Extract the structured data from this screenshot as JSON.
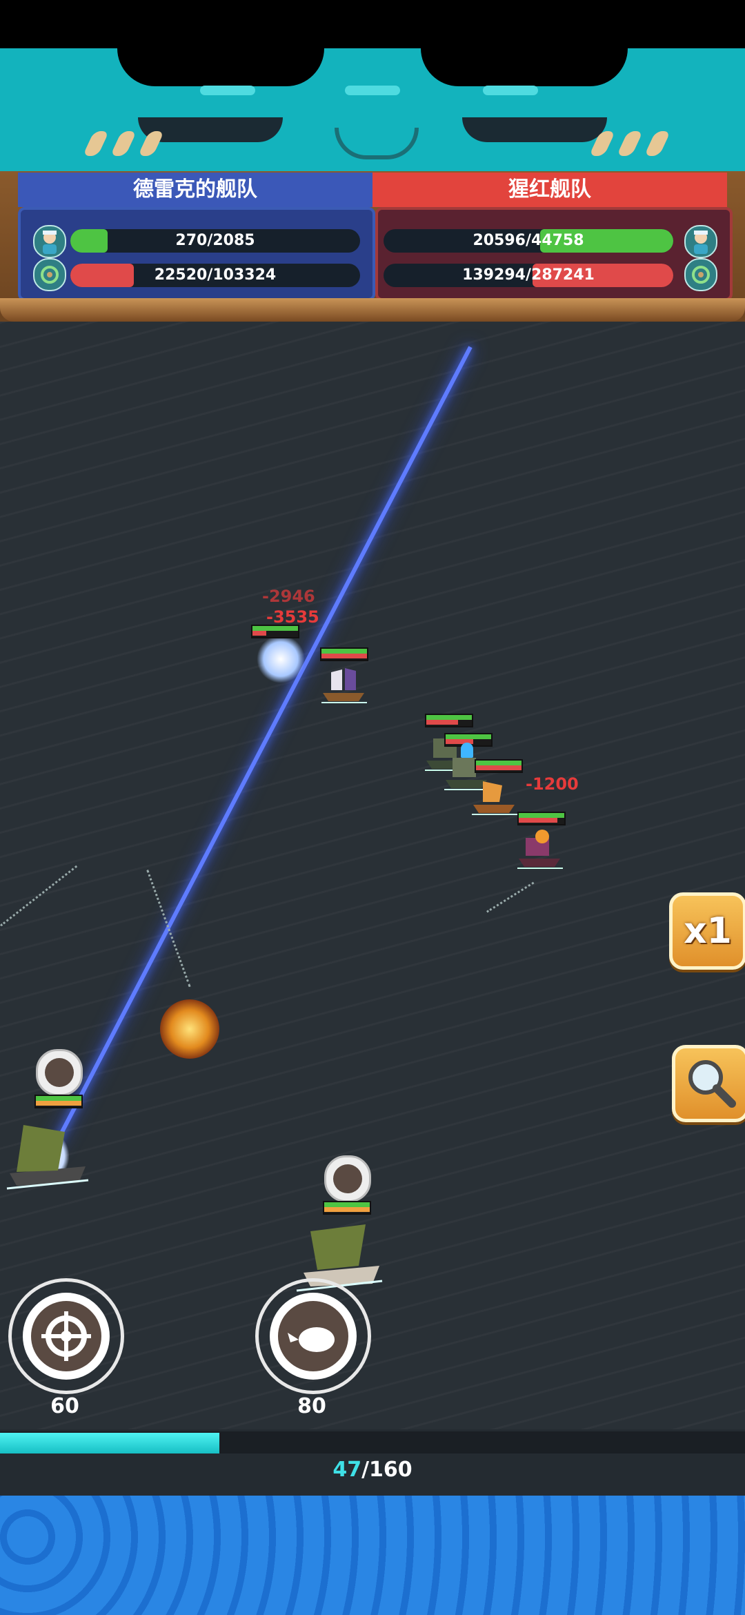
{
  "colors": {
    "mascot": "#13b3bd",
    "blue_team": "#3b58b8",
    "red_team": "#e2443d",
    "hp_green": "#4ec443",
    "hp_red": "#e04a4a",
    "laser": "#5f7cff",
    "progress": "#17bfc4",
    "sea": "#293036"
  },
  "header": {
    "left_team": {
      "name": "德雷克的舰队",
      "crew": {
        "text": "270/2085",
        "current": 270,
        "max": 2085,
        "icon": "sailor-icon"
      },
      "ships": {
        "text": "22520/103324",
        "current": 22520,
        "max": 103324,
        "icon": "ship-helm-icon"
      }
    },
    "right_team": {
      "name": "猩红舰队",
      "crew": {
        "text": "20596/44758",
        "current": 20596,
        "max": 44758,
        "icon": "sailor-icon"
      },
      "ships": {
        "text": "139294/287241",
        "current": 139294,
        "max": 287241,
        "icon": "ship-helm-icon"
      }
    }
  },
  "battle": {
    "damage_numbers": [
      "-2946",
      "-3535",
      "-1200"
    ],
    "enemy_ships": [
      {
        "name": "enemy-ship-exploding",
        "hp": 0.15
      },
      {
        "name": "enemy-ship-purple-galleon",
        "hp": 0.9
      },
      {
        "name": "enemy-ship-green-1",
        "hp": 0.85
      },
      {
        "name": "enemy-ship-green-2",
        "hp": 0.8
      },
      {
        "name": "enemy-ship-junk",
        "hp": 0.95
      },
      {
        "name": "enemy-ship-burning",
        "hp": 0.75
      }
    ],
    "ally_ships": [
      {
        "name": "ally-ship-left",
        "hp": 0.9
      },
      {
        "name": "ally-ship-center",
        "hp": 0.95
      }
    ]
  },
  "controls": {
    "speed_label": "x1",
    "zoom_icon": "magnifier-icon",
    "skills": [
      {
        "icon": "helm-wheel-icon",
        "cost": "60"
      },
      {
        "icon": "cannonball-icon",
        "cost": "80"
      }
    ]
  },
  "progress": {
    "current": "47",
    "separator": "/",
    "max": "160",
    "fraction": 0.294
  }
}
